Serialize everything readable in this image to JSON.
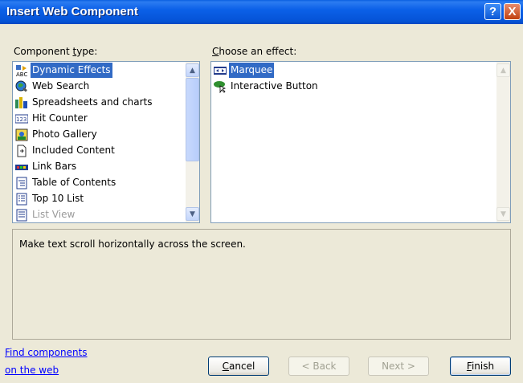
{
  "window": {
    "title": "Insert Web Component",
    "help": "?",
    "close": "X"
  },
  "component_type": {
    "label_pre": "Component ",
    "label_mnemonic": "t",
    "label_post": "ype:",
    "items": [
      {
        "label": "Dynamic Effects",
        "icon": "dynamic-effects-icon",
        "selected": true
      },
      {
        "label": "Web Search",
        "icon": "web-search-icon"
      },
      {
        "label": "Spreadsheets and charts",
        "icon": "spreadsheets-icon"
      },
      {
        "label": "Hit Counter",
        "icon": "hit-counter-icon"
      },
      {
        "label": "Photo Gallery",
        "icon": "photo-gallery-icon"
      },
      {
        "label": "Included Content",
        "icon": "included-content-icon"
      },
      {
        "label": "Link Bars",
        "icon": "link-bars-icon"
      },
      {
        "label": "Table of Contents",
        "icon": "table-of-contents-icon"
      },
      {
        "label": "Top 10 List",
        "icon": "top-10-list-icon"
      },
      {
        "label": "List View",
        "icon": "list-view-icon",
        "disabled": true
      }
    ]
  },
  "effect": {
    "label_pre": "",
    "label_mnemonic": "C",
    "label_post": "hoose an effect:",
    "items": [
      {
        "label": "Marquee",
        "icon": "marquee-icon",
        "selected": true
      },
      {
        "label": "Interactive Button",
        "icon": "interactive-button-icon"
      }
    ]
  },
  "description": "Make text scroll horizontally across the screen.",
  "find_link": {
    "line1": "Find components",
    "line2": "on the web"
  },
  "buttons": {
    "cancel": "Cancel",
    "back": "< Back",
    "next": "Next >",
    "finish": "Finish"
  }
}
